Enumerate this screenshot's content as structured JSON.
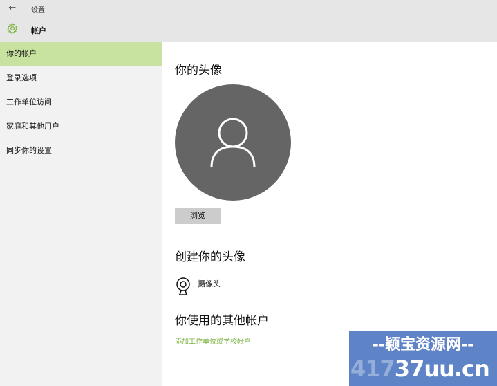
{
  "window": {
    "back_glyph": "←",
    "title": "设置"
  },
  "header": {
    "icon": "gear-icon",
    "title": "帐户"
  },
  "sidebar": {
    "items": [
      {
        "label": "你的帐户",
        "active": true
      },
      {
        "label": "登录选项",
        "active": false
      },
      {
        "label": "工作单位访问",
        "active": false
      },
      {
        "label": "家庭和其他用户",
        "active": false
      },
      {
        "label": "同步你的设置",
        "active": false
      }
    ]
  },
  "main": {
    "avatar_section_title": "你的头像",
    "browse_label": "浏览",
    "create_section_title": "创建你的头像",
    "camera_label": "摄像头",
    "other_accounts_title": "你使用的其他帐户",
    "add_account_link": "添加工作单位或学校帐户"
  },
  "watermark": {
    "top_text": "--颖宝资源网--",
    "bottom_faint": "417",
    "bottom_text": "37uu.cn"
  },
  "colors": {
    "accent": "#7cb342",
    "active_nav": "#c8e2a0",
    "avatar_bg": "#656566",
    "titlebar_bg": "#e6e6e6",
    "sidebar_bg": "#f2f2f2"
  }
}
